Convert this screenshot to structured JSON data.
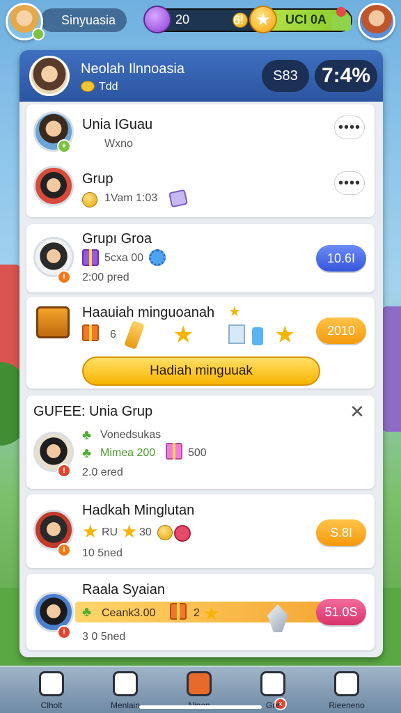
{
  "hud": {
    "player_name": "Sinyuasia",
    "gems": "20",
    "coins": "6!",
    "level_text": "UCI 0A",
    "progress": 0.44
  },
  "panel": {
    "header": {
      "title": "Neolah Ilnnoasia",
      "coin_text": "Tdd",
      "pill_a": "S83",
      "pill_b": "7:4%"
    },
    "row1": {
      "title": "Unia IGuau",
      "subtitle": "Wxno",
      "more_label": "••••"
    },
    "row2": {
      "title": "Grup",
      "subtitle": "1Vam 1:03",
      "more_label": "••••"
    },
    "card_group": {
      "title": "Grupı Groa",
      "reward": "5cxa 00",
      "time": "2:00 pred",
      "button": "10.6I"
    },
    "card_weekly": {
      "title": "Haauiah minguoanah",
      "count": "6",
      "button": "2010",
      "claim_button": "Hadiah minguuak"
    },
    "card_gufee": {
      "title": "GUFEE: Unia Grup",
      "line1": "Vonedsukas",
      "line2": "Mimea 200",
      "line2_value": "500",
      "time": "2.0 ered",
      "close": "✕"
    },
    "card_hadkah": {
      "title": "Hadkah Minglutan",
      "reward_text": "RU",
      "reward_value": "30",
      "time": "10 5ned",
      "button": "S.8I"
    },
    "card_raala": {
      "title": "Raala Syaian",
      "reward": "Ceank3.00",
      "reward_badge": "2",
      "time": "3 0 5ned",
      "button": "51.0S"
    }
  },
  "bottom_nav": {
    "items": [
      {
        "label": "Clholt"
      },
      {
        "label": "Menlain"
      },
      {
        "label": "Ninen"
      },
      {
        "label": "Gre"
      },
      {
        "label": "Rieeneno"
      }
    ],
    "badge_text": "x"
  }
}
